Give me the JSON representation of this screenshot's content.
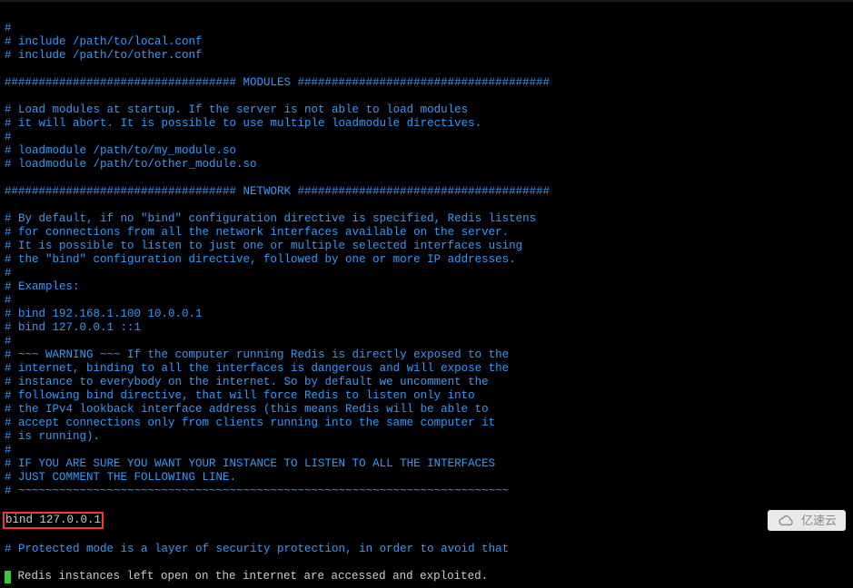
{
  "config_file": {
    "lines": [
      "#",
      "# include /path/to/local.conf",
      "# include /path/to/other.conf",
      "",
      "################################## MODULES #####################################",
      "",
      "# Load modules at startup. If the server is not able to load modules",
      "# it will abort. It is possible to use multiple loadmodule directives.",
      "#",
      "# loadmodule /path/to/my_module.so",
      "# loadmodule /path/to/other_module.so",
      "",
      "################################## NETWORK #####################################",
      "",
      "# By default, if no \"bind\" configuration directive is specified, Redis listens",
      "# for connections from all the network interfaces available on the server.",
      "# It is possible to listen to just one or multiple selected interfaces using",
      "# the \"bind\" configuration directive, followed by one or more IP addresses.",
      "#",
      "# Examples:",
      "#",
      "# bind 192.168.1.100 10.0.0.1",
      "# bind 127.0.0.1 ::1",
      "#",
      "# ~~~ WARNING ~~~ If the computer running Redis is directly exposed to the",
      "# internet, binding to all the interfaces is dangerous and will expose the",
      "# instance to everybody on the internet. So by default we uncomment the",
      "# following bind directive, that will force Redis to listen only into",
      "# the IPv4 lookback interface address (this means Redis will be able to",
      "# accept connections only from clients running into the same computer it",
      "# is running).",
      "#",
      "# IF YOU ARE SURE YOU WANT YOUR INSTANCE TO LISTEN TO ALL THE INTERFACES",
      "# JUST COMMENT THE FOLLOWING LINE.",
      "# ~~~~~~~~~~~~~~~~~~~~~~~~~~~~~~~~~~~~~~~~~~~~~~~~~~~~~~~~~~~~~~~~~~~~~~~~"
    ],
    "highlighted_line": "bind 127.0.0.1",
    "lines_after": [
      "",
      "# Protected mode is a layer of security protection, in order to avoid that"
    ],
    "last_line_prefix": "#",
    "last_line_rest": " Redis instances left open on the internet are accessed and exploited."
  },
  "watermark": {
    "text": "亿速云"
  }
}
